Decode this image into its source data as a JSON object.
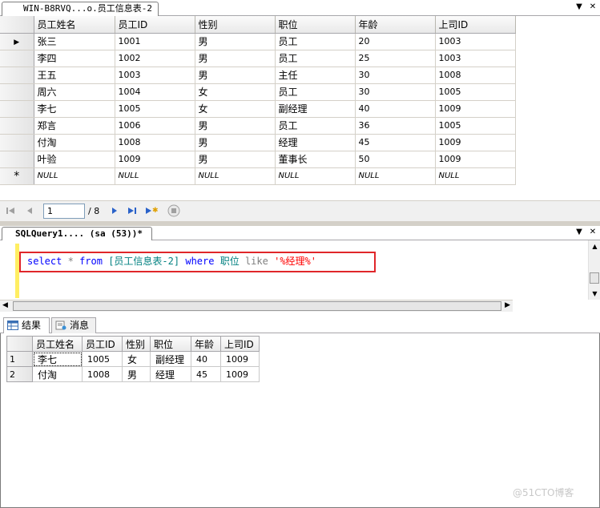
{
  "top_tab": {
    "title": "WIN-B8RVQ...o.员工信息表-2"
  },
  "top_grid": {
    "columns": [
      "员工姓名",
      "员工ID",
      "性别",
      "职位",
      "年龄",
      "上司ID"
    ],
    "rows": [
      [
        "张三",
        "1001",
        "男",
        "员工",
        "20",
        "1003"
      ],
      [
        "李四",
        "1002",
        "男",
        "员工",
        "25",
        "1003"
      ],
      [
        "王五",
        "1003",
        "男",
        "主任",
        "30",
        "1008"
      ],
      [
        "周六",
        "1004",
        "女",
        "员工",
        "30",
        "1005"
      ],
      [
        "李七",
        "1005",
        "女",
        "副经理",
        "40",
        "1009"
      ],
      [
        "郑言",
        "1006",
        "男",
        "员工",
        "36",
        "1005"
      ],
      [
        "付淘",
        "1008",
        "男",
        "经理",
        "45",
        "1009"
      ],
      [
        "叶验",
        "1009",
        "男",
        "董事长",
        "50",
        "1009"
      ]
    ],
    "new_row": [
      "NULL",
      "NULL",
      "NULL",
      "NULL",
      "NULL",
      "NULL"
    ],
    "current_row_marker": "▶",
    "new_row_marker": "*"
  },
  "navigator": {
    "current_record": "1",
    "total": "/ 8"
  },
  "query_tab": {
    "title": "SQLQuery1....  (sa (53))*"
  },
  "query": {
    "kw_select": "select",
    "op_star": "*",
    "kw_from": "from",
    "table": "[员工信息表-2]",
    "kw_where": "where",
    "column": "职位",
    "op_like": "like",
    "pattern": "'%经理%'"
  },
  "results_tabs": {
    "results_label": "结果",
    "messages_label": "消息"
  },
  "results_grid": {
    "columns": [
      "员工姓名",
      "员工ID",
      "性别",
      "职位",
      "年龄",
      "上司ID"
    ],
    "rows": [
      [
        "1",
        "李七",
        "1005",
        "女",
        "副经理",
        "40",
        "1009"
      ],
      [
        "2",
        "付淘",
        "1008",
        "男",
        "经理",
        "45",
        "1009"
      ]
    ]
  },
  "watermark": "@51CTO博客",
  "colors": {
    "keyword": "#0000ff",
    "identifier": "#008080",
    "string": "#ff0000",
    "operator": "#808080",
    "highlight_box": "#e0262a"
  }
}
